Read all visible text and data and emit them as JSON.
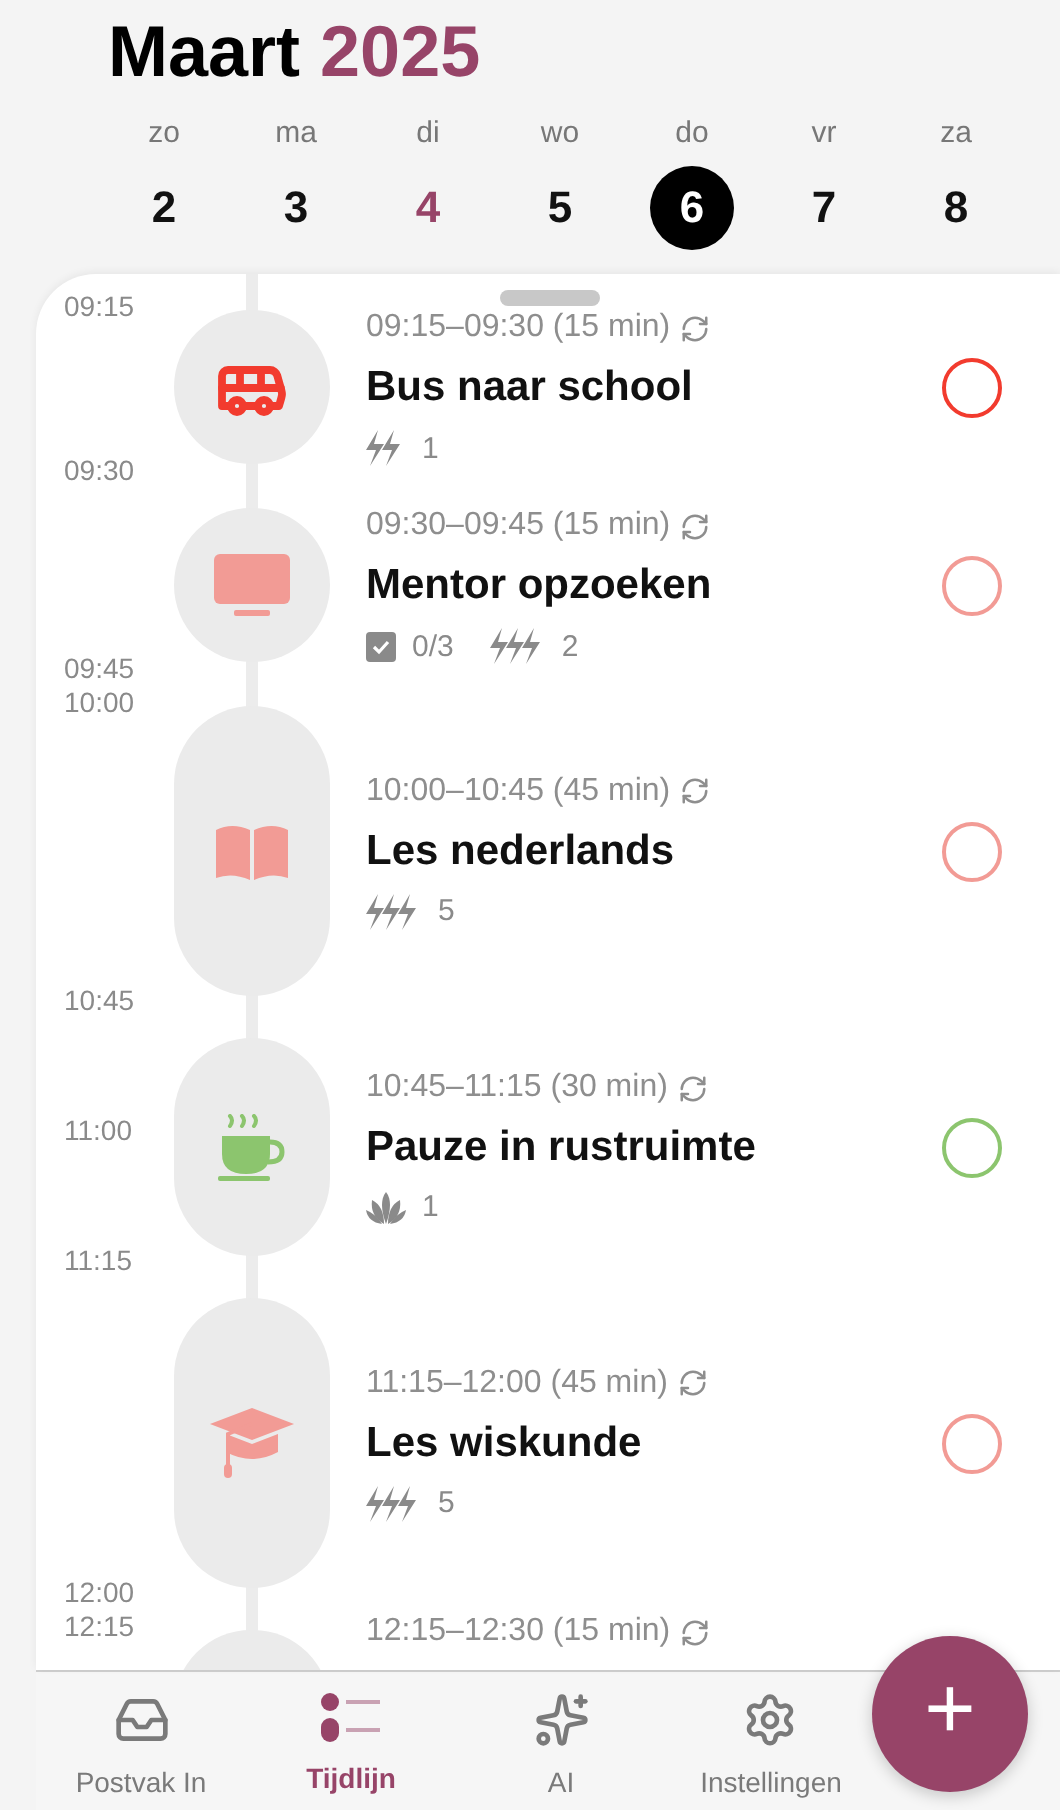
{
  "header": {
    "month": "Maart",
    "year": "2025"
  },
  "week": [
    {
      "day": "zo",
      "date": "2",
      "today": false,
      "selected": false
    },
    {
      "day": "ma",
      "date": "3",
      "today": false,
      "selected": false
    },
    {
      "day": "di",
      "date": "4",
      "today": true,
      "selected": false
    },
    {
      "day": "wo",
      "date": "5",
      "today": false,
      "selected": false
    },
    {
      "day": "do",
      "date": "6",
      "today": false,
      "selected": true
    },
    {
      "day": "vr",
      "date": "7",
      "today": false,
      "selected": false
    },
    {
      "day": "za",
      "date": "8",
      "today": false,
      "selected": false
    }
  ],
  "events": [
    {
      "time": "09:15–09:30 (15 min)",
      "title": "Bus naar school",
      "kind": "bus",
      "color": "#f23b2e",
      "done": false,
      "top_labels": [
        "09:15"
      ],
      "bottom_labels": [
        "09:30"
      ],
      "meta": [
        {
          "kind": "double-bolt",
          "text": "1"
        }
      ]
    },
    {
      "time": "09:30–09:45 (15 min)",
      "title": "Mentor opzoeken",
      "kind": "monitor",
      "color": "#f29b95",
      "done": false,
      "bottom_labels": [
        "09:45"
      ],
      "meta": [
        {
          "kind": "checklist",
          "text": "0/3"
        },
        {
          "kind": "triple-bolt",
          "text": "2"
        }
      ]
    },
    {
      "time": "10:00–10:45 (45 min)",
      "title": "Les nederlands",
      "kind": "book",
      "color": "#f29b95",
      "done": false,
      "top_labels": [
        "10:00"
      ],
      "bottom_labels": [
        "10:45"
      ],
      "meta": [
        {
          "kind": "triple-bolt",
          "text": "5"
        }
      ]
    },
    {
      "time": "10:45–11:15 (30 min)",
      "title": "Pauze in rustruimte",
      "kind": "cup",
      "color": "#8cc56e",
      "done": false,
      "middle_labels": [
        "11:00"
      ],
      "bottom_labels": [
        "11:15"
      ],
      "meta": [
        {
          "kind": "lotus",
          "text": "1"
        }
      ]
    },
    {
      "time": "11:15–12:00 (45 min)",
      "title": "Les wiskunde",
      "kind": "cap",
      "color": "#f29b95",
      "done": false,
      "bottom_labels": [
        "12:00"
      ],
      "meta": [
        {
          "kind": "triple-bolt",
          "text": "5"
        }
      ]
    },
    {
      "time": "12:15–12:30 (15 min)",
      "kind": "partial",
      "top_labels": [
        "12:15"
      ]
    }
  ],
  "tabs": [
    {
      "label": "Postvak In",
      "kind": "inbox",
      "selected": false
    },
    {
      "label": "Tijdlijn",
      "kind": "list",
      "selected": true
    },
    {
      "label": "AI",
      "kind": "sparkles",
      "selected": false
    },
    {
      "label": "Instellingen",
      "kind": "gear",
      "selected": false
    }
  ],
  "fab": "+"
}
